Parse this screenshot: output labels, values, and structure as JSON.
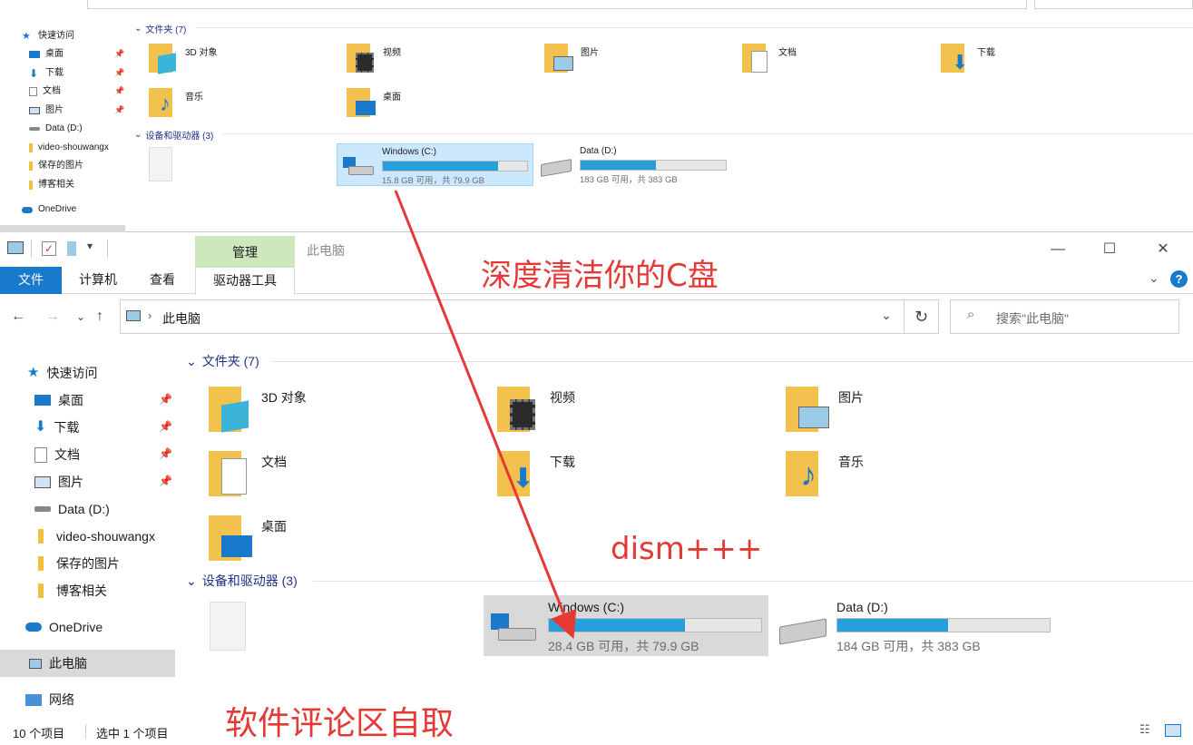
{
  "top_window": {
    "nav": {
      "quick_access": "快速访问",
      "items": [
        {
          "label": "桌面",
          "icon": "desktop-icon",
          "pinned": true
        },
        {
          "label": "下载",
          "icon": "download-icon",
          "pinned": true
        },
        {
          "label": "文档",
          "icon": "document-icon",
          "pinned": true
        },
        {
          "label": "图片",
          "icon": "pictures-icon",
          "pinned": true
        },
        {
          "label": "Data (D:)",
          "icon": "drive-icon",
          "pinned": false
        },
        {
          "label": "video-shouwangx",
          "icon": "folder-icon",
          "pinned": false
        },
        {
          "label": "保存的图片",
          "icon": "folder-icon",
          "pinned": false
        },
        {
          "label": "博客相关",
          "icon": "folder-icon",
          "pinned": false
        }
      ],
      "onedrive": "OneDrive"
    },
    "folders_header": "文件夹 (7)",
    "folders": [
      "3D 对象",
      "视频",
      "图片",
      "文档",
      "下载",
      "音乐",
      "桌面"
    ],
    "devices_header": "设备和驱动器 (3)",
    "drives": [
      {
        "name": "Windows (C:)",
        "info": "15.8 GB 可用，共 79.9 GB",
        "used_fraction": 0.8
      },
      {
        "name": "Data (D:)",
        "info": "183 GB 可用，共 383 GB",
        "used_fraction": 0.52
      }
    ]
  },
  "main_window": {
    "title": "此电脑",
    "context_tab": "管理",
    "ribbon_tabs": {
      "file": "文件",
      "computer": "计算机",
      "view": "查看",
      "drive_tools": "驱动器工具"
    },
    "address": {
      "path": "此电脑",
      "search_placeholder": "搜索\"此电脑\""
    },
    "nav": {
      "quick_access": "快速访问",
      "items": [
        {
          "label": "桌面",
          "pinned": true
        },
        {
          "label": "下载",
          "pinned": true
        },
        {
          "label": "文档",
          "pinned": true
        },
        {
          "label": "图片",
          "pinned": true
        },
        {
          "label": "Data (D:)",
          "pinned": false
        },
        {
          "label": "video-shouwangx",
          "pinned": false
        },
        {
          "label": "保存的图片",
          "pinned": false
        },
        {
          "label": "博客相关",
          "pinned": false
        }
      ],
      "onedrive": "OneDrive",
      "this_pc": "此电脑",
      "network": "网络"
    },
    "folders_header": "文件夹 (7)",
    "folders": [
      "3D 对象",
      "视频",
      "图片",
      "文档",
      "下载",
      "音乐",
      "桌面"
    ],
    "devices_header": "设备和驱动器 (3)",
    "drives": [
      {
        "name": "Windows (C:)",
        "info": "28.4 GB 可用，共 79.9 GB",
        "used_fraction": 0.64
      },
      {
        "name": "Data (D:)",
        "info": "184 GB 可用，共 383 GB",
        "used_fraction": 0.52
      }
    ],
    "status": {
      "items": "10 个项目",
      "selected": "选中 1 个项目"
    }
  },
  "annotations": {
    "headline": "深度清洁你的C盘",
    "tool": "dism+++",
    "footer": "软件评论区自取"
  },
  "colors": {
    "accent": "#1979ca",
    "drive_fill": "#26a0da",
    "annotation": "#e53935",
    "context_tab": "#cde8bc"
  }
}
